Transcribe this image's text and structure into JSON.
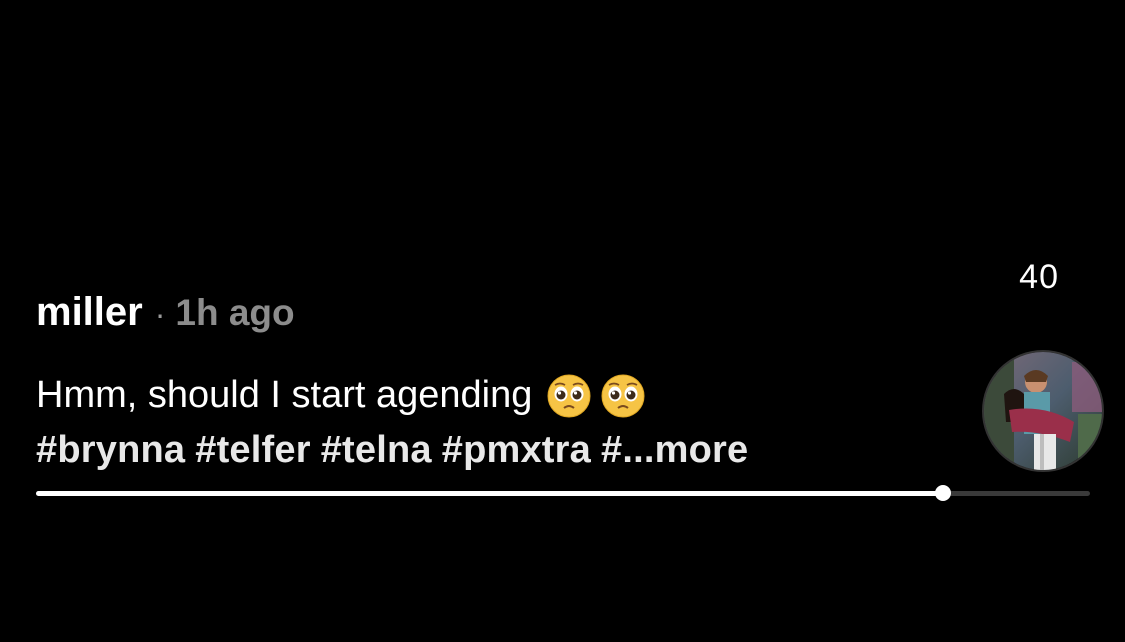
{
  "post": {
    "count": "40",
    "username": "miller",
    "separator": "·",
    "time": "1h ago",
    "caption": "Hmm, should I start agending",
    "emojis": [
      "pleading-face-icon",
      "pleading-face-icon"
    ],
    "hashtags": [
      "#brynna",
      "#telfer",
      "#telna",
      "#pmxtra"
    ],
    "more_label": "#...more"
  },
  "progress": {
    "fraction": 0.861
  },
  "colors": {
    "background": "#000000",
    "text": "#ffffff",
    "muted": "#8c8c8c",
    "track": "#3a3a3a"
  }
}
